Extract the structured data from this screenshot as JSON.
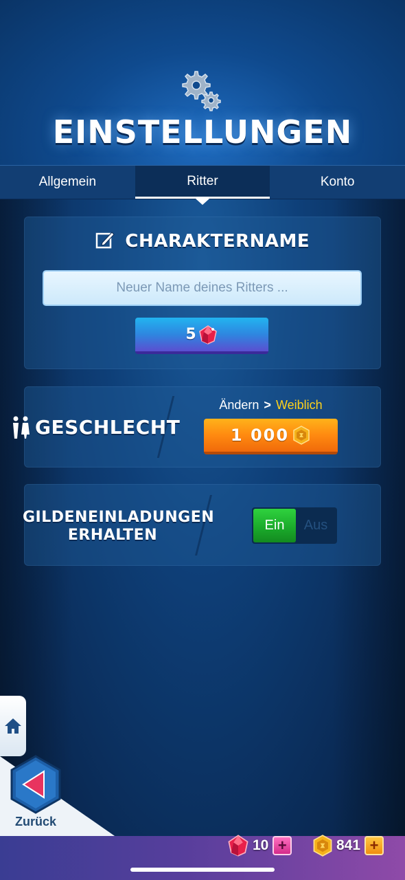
{
  "header": {
    "title": "EINSTELLUNGEN",
    "icon": "gears-icon"
  },
  "tabs": [
    {
      "label": "Allgemein",
      "active": false
    },
    {
      "label": "Ritter",
      "active": true
    },
    {
      "label": "Konto",
      "active": false
    }
  ],
  "character_name": {
    "title": "CHARAKTERNAME",
    "icon": "edit-icon",
    "input_value": "",
    "input_placeholder": "Neuer Name deines Ritters ...",
    "cost": "5",
    "cost_icon": "gem-icon"
  },
  "gender": {
    "title": "GESCHLECHT",
    "icon": "gender-icon",
    "change_label": "Ändern",
    "arrow": ">",
    "target_value": "Weiblich",
    "cost": "1 000",
    "cost_icon": "gold-coin-icon"
  },
  "guild_invites": {
    "title_line1": "GILDENEINLADUNGEN",
    "title_line2": "ERHALTEN",
    "on_label": "Ein",
    "off_label": "Aus",
    "state": "on"
  },
  "nav": {
    "home_icon": "home-icon",
    "back_label": "Zurück",
    "back_icon": "back-arrow-icon"
  },
  "currency": {
    "gems": "10",
    "gold": "841",
    "plus": "+"
  },
  "colors": {
    "accent_yellow": "#ffd21a",
    "gem_button": "#2e86e0",
    "gold_button": "#ff8a10",
    "toggle_on": "#1aa82a"
  }
}
